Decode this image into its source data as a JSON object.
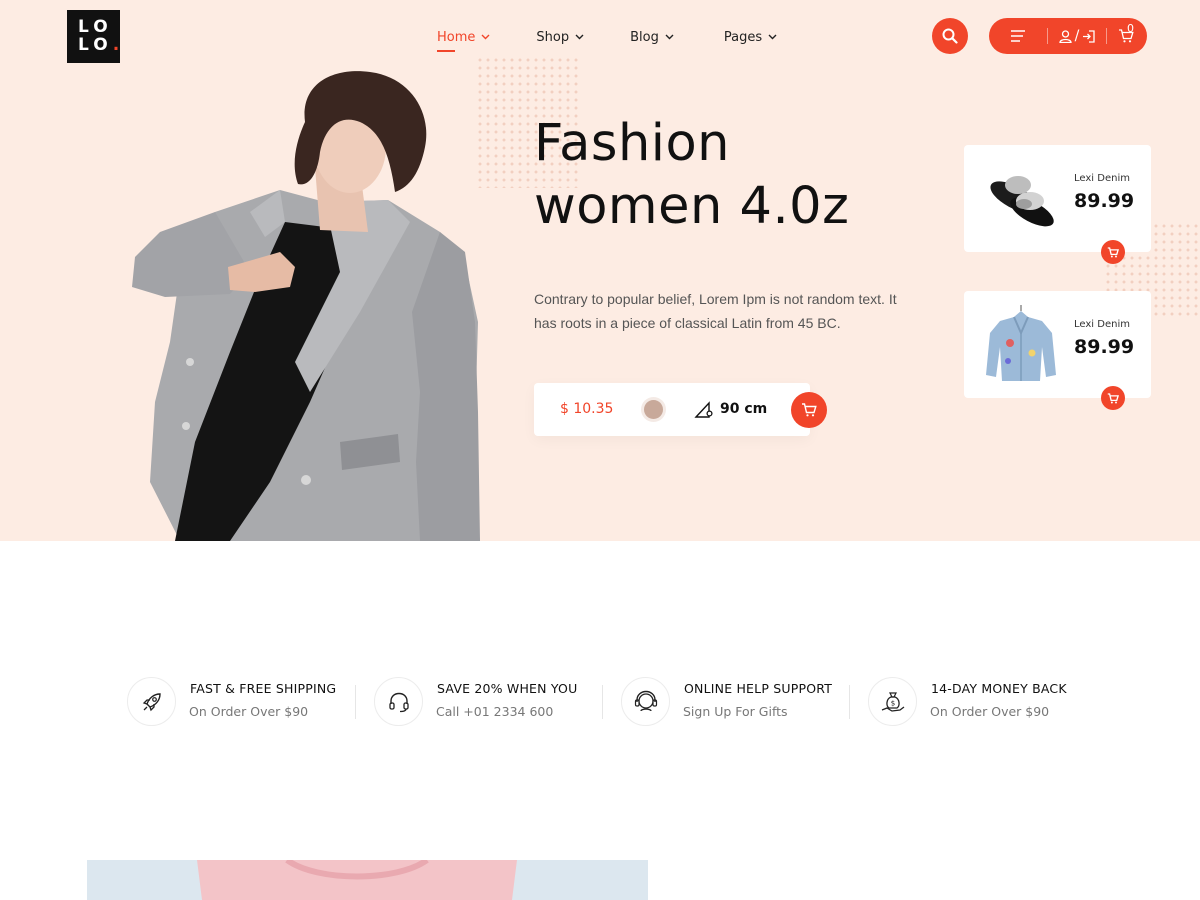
{
  "brand": {
    "logo_line1": "LO",
    "logo_line2": "LO",
    "logo_dot": ".",
    "accent": "#f1452a"
  },
  "nav": {
    "items": [
      {
        "label": "Home",
        "active": true
      },
      {
        "label": "Shop",
        "active": false
      },
      {
        "label": "Blog",
        "active": false
      },
      {
        "label": "Pages",
        "active": false
      }
    ]
  },
  "header": {
    "cart_count": "0",
    "account_separator": "/",
    "icons": [
      "search-icon",
      "menu-icon",
      "user-icon",
      "login-icon",
      "cart-icon"
    ]
  },
  "hero": {
    "title_line1": "Fashion",
    "title_line2": "women 4.0z",
    "description": "Contrary to popular belief, Lorem Ipm is not random text. It has roots in a piece of classical Latin from 45 BC.",
    "price": "$ 10.35",
    "swatch_color": "#c8a99a",
    "size": "90 cm"
  },
  "products": [
    {
      "name": "Lexi Denim",
      "price": "89.99",
      "image": "fur-shoes"
    },
    {
      "name": "Lexi Denim",
      "price": "89.99",
      "image": "denim-jacket"
    }
  ],
  "features": [
    {
      "title": "FAST & FREE SHIPPING",
      "subtitle": "On Order Over $90",
      "icon": "rocket-icon"
    },
    {
      "title": "SAVE 20% WHEN YOU",
      "subtitle": "Call +01 2334 600",
      "icon": "headphones-icon"
    },
    {
      "title": "ONLINE HELP SUPPORT",
      "subtitle": "Sign Up For Gifts",
      "icon": "headset-icon"
    },
    {
      "title": "14-DAY MONEY BACK",
      "subtitle": "On Order Over $90",
      "icon": "money-bag-icon"
    }
  ]
}
